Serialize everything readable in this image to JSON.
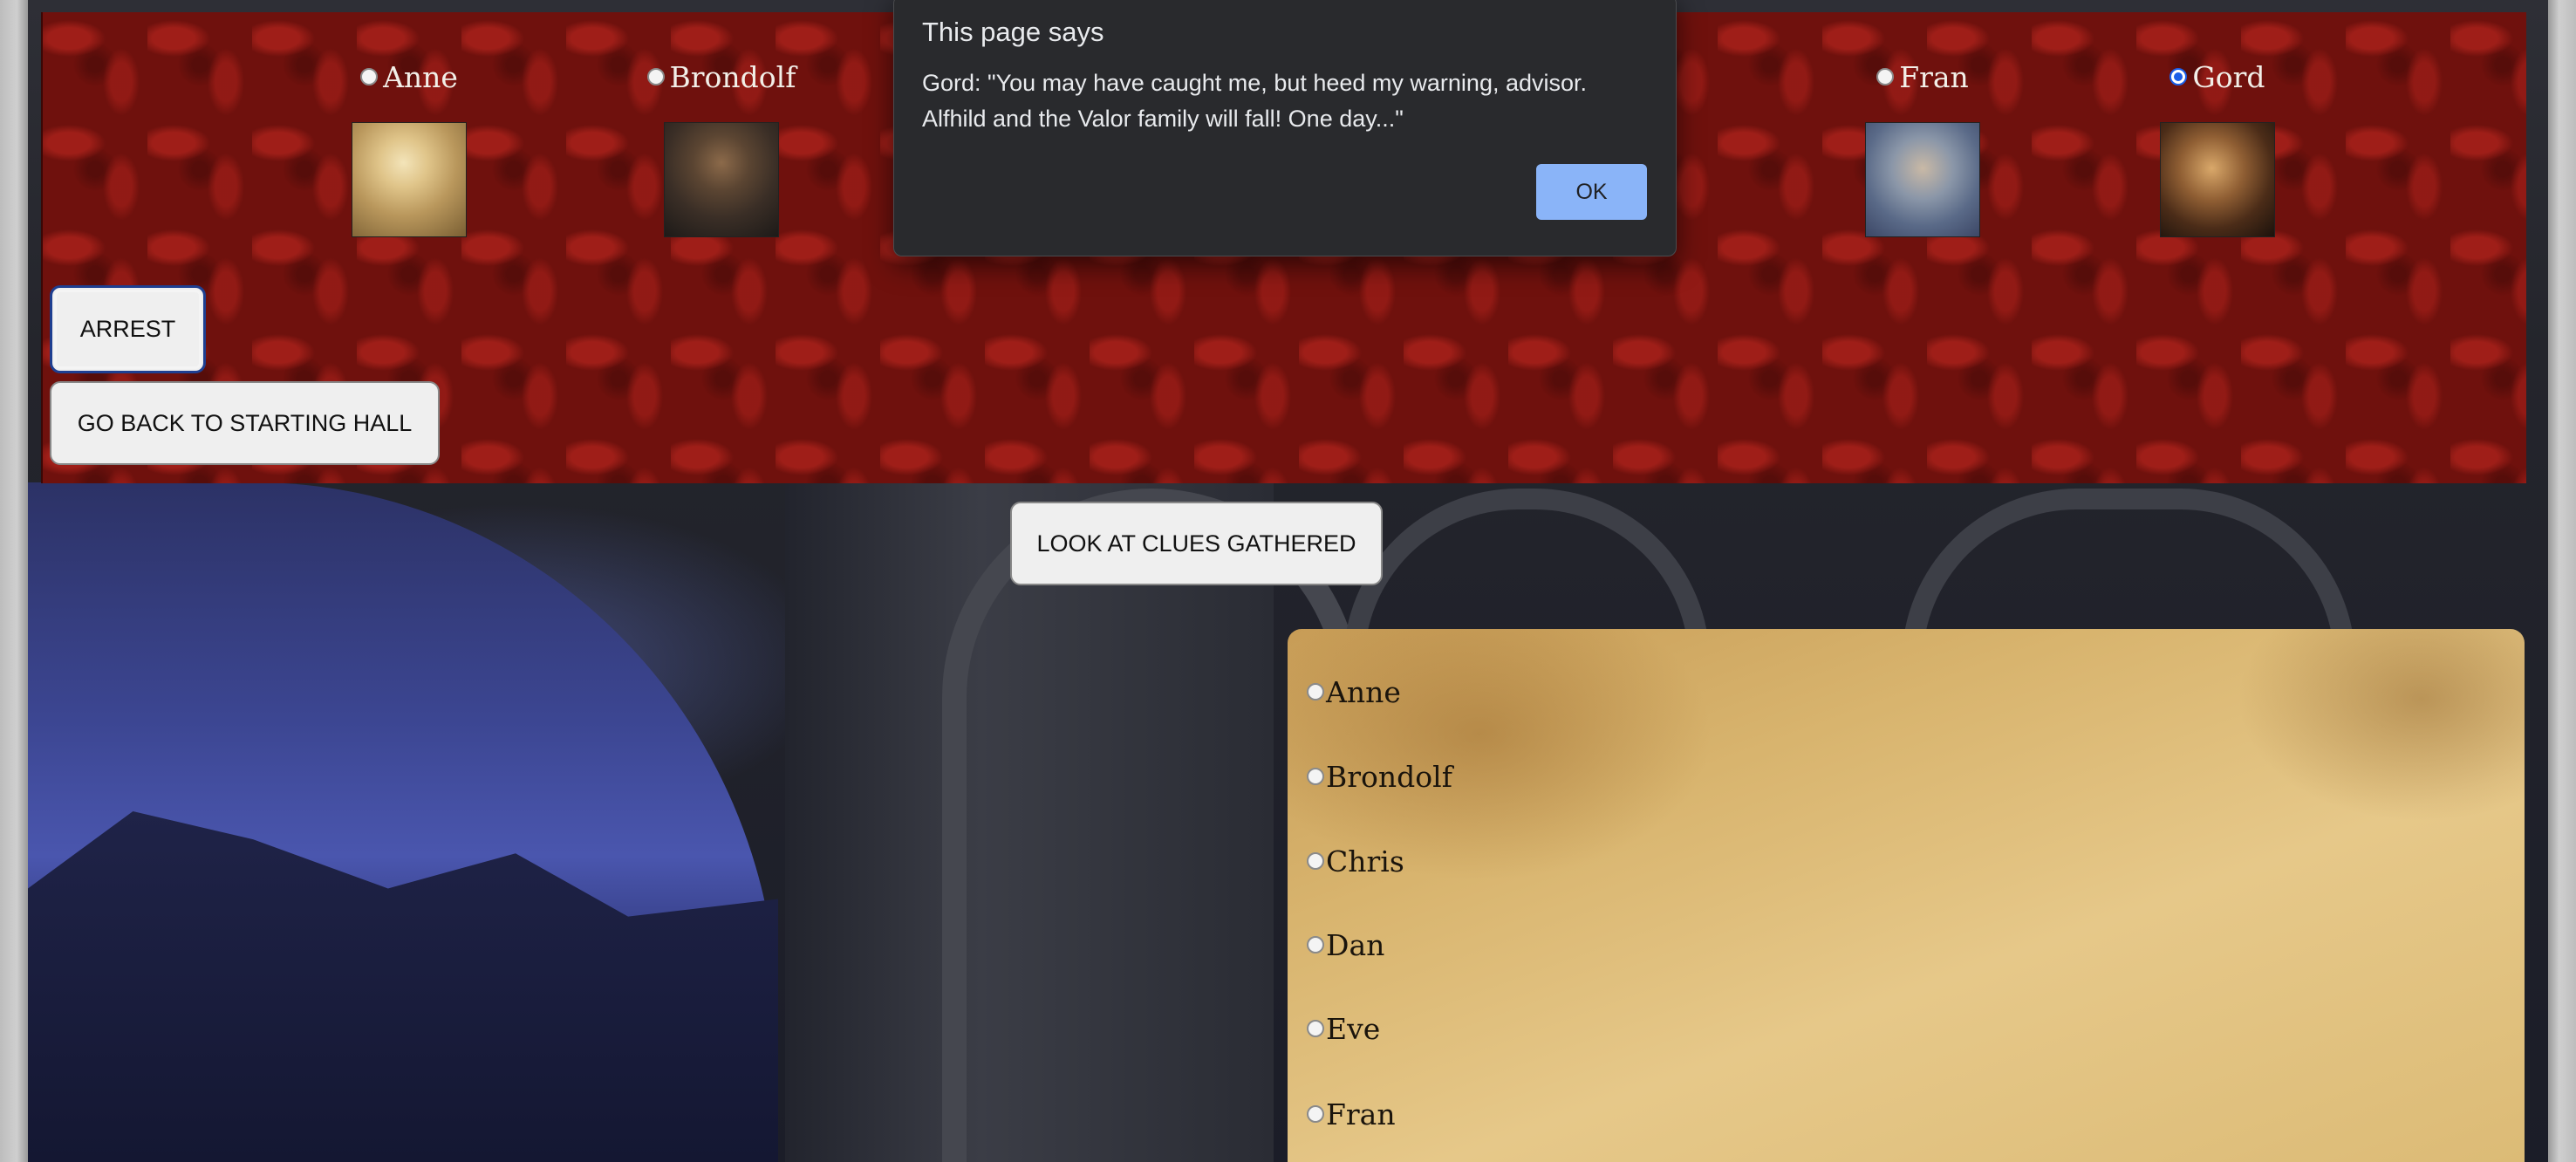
{
  "dialog": {
    "title": "This page says",
    "message": "Gord: \"You may have caught me, but heed my warning, advisor. Alfhild and the Valor family will fall! One day...\"",
    "ok_label": "OK"
  },
  "suspects": [
    {
      "name": "Anne",
      "selected": false,
      "portrait": "anne-portrait"
    },
    {
      "name": "Brondolf",
      "selected": false,
      "portrait": "brondolf-portrait"
    },
    {
      "name": "Fran",
      "selected": false,
      "portrait": "fran-portrait"
    },
    {
      "name": "Gord",
      "selected": true,
      "portrait": "gord-portrait"
    }
  ],
  "buttons": {
    "arrest": "ARREST",
    "back": "GO BACK TO STARTING HALL",
    "clues": "LOOK AT CLUES GATHERED"
  },
  "clue_list": [
    {
      "name": "Anne",
      "selected": false
    },
    {
      "name": "Brondolf",
      "selected": false
    },
    {
      "name": "Chris",
      "selected": false
    },
    {
      "name": "Dan",
      "selected": false
    },
    {
      "name": "Eve",
      "selected": false
    },
    {
      "name": "Fran",
      "selected": false
    }
  ],
  "colors": {
    "panel_red": "#6f110d",
    "dialog_bg": "#292a2d",
    "ok_button": "#8ab4f8",
    "radio_checked": "#1a5ee8"
  }
}
